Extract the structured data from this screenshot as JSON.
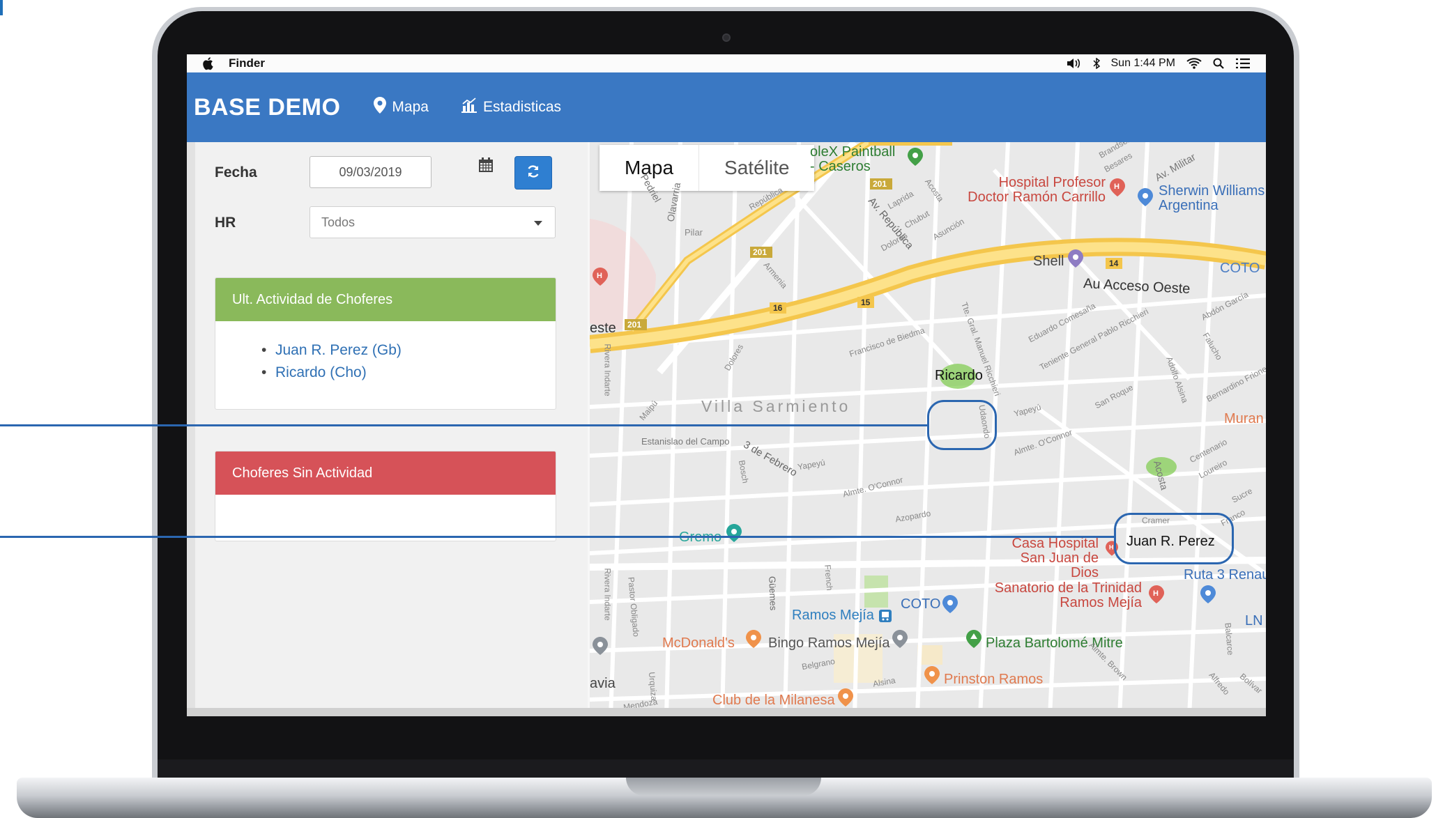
{
  "menubar": {
    "app_name": "Finder",
    "clock": "Sun 1:44 PM",
    "icons": [
      "apple-icon",
      "volume-icon",
      "bluetooth-icon",
      "wifi-icon",
      "search-icon",
      "list-icon"
    ]
  },
  "navbar": {
    "brand": "BASE DEMO",
    "links": [
      {
        "label": "Mapa",
        "icon": "map-marker-icon"
      },
      {
        "label": "Estadisticas",
        "icon": "bar-chart-icon"
      }
    ],
    "color": "#3a78c3"
  },
  "filters": {
    "date_label": "Fecha",
    "date_value": "09/03/2019",
    "hr_label": "HR",
    "hr_value": "Todos"
  },
  "panels": {
    "active": {
      "title": "Ult. Actividad de Choferes",
      "drivers": [
        "Juan R. Perez (Gb)",
        "Ricardo (Cho)"
      ],
      "color": "#8ab95b"
    },
    "inactive": {
      "title": "Choferes Sin Actividad",
      "color": "#d65258"
    }
  },
  "map": {
    "type_buttons": [
      "Mapa",
      "Satélite"
    ],
    "active_type": "Mapa",
    "markers": [
      "Ricardo",
      "Juan R. Perez"
    ],
    "places": {
      "paintball": "oleX Paintball - Caseros",
      "hospital_carrillo": "Hospital Profesor Doctor Ramón Carrillo",
      "sherwin": "Sherwin Williams Argentina",
      "shell": "Shell",
      "coto_top": "COTO",
      "acceso_oeste": "Au Acceso Oeste",
      "este": "este",
      "villa_sarmiento": "Villa Sarmiento",
      "murano": "Muran",
      "casa_hospital": "Casa Hospital San Juan de Dios",
      "ruta3": "Ruta 3 Renau",
      "sanatorio": "Sanatorio de la Trinidad Ramos Mejía",
      "ramos_mejia": "Ramos Mejía",
      "coto_bottom": "COTO",
      "mcdonalds": "McDonald's",
      "bingo": "Bingo Ramos Mejía",
      "plaza": "Plaza Bartolomé Mitre",
      "prinston": "Prinston Ramos",
      "milanesa": "Club de la Milanesa",
      "gremo": "Gremo",
      "ln": "LN",
      "via": "avia"
    },
    "streets": {
      "av_militar": "Av. Militar",
      "besares": "Besares",
      "brandsen": "Brandsen",
      "pedriel": "Pedriel",
      "olavarria": "Olavarria",
      "pilar": "Pilar",
      "republica": "República",
      "av_republica": "Av. República",
      "laprida": "Laprida",
      "acosta": "Acosta",
      "chubut": "Chubut",
      "asuncion": "Asunción",
      "dolores": "Dolores",
      "armenia": "Armenia",
      "francisco_biedma": "Francisco de Biedma",
      "tte_manuel": "Tte. Gral. Manuel Ricchieri",
      "eduardo_comesana": "Eduardo Comesaña",
      "pablo_ricchieri": "Teniente General Pablo Ricchieri",
      "abdon_garcia": "Abdón García",
      "rivera_indarte": "Rivera Indarte",
      "dolores2": "Dolores",
      "falucho": "Falucho",
      "bernardino": "Bernardino Frione",
      "adolfo_alsina": "Adolfo Alsina",
      "san_roque": "San Roque",
      "yapeyu": "Yapeyú",
      "maipu": "Maipú",
      "estanislao": "Estanislao del Campo",
      "tres_febrero": "3 de Febrero",
      "bosch": "Bosch",
      "yapeyu2": "Yapeyú",
      "almte_oconnor": "Almte. O'Connor",
      "almte_oconnor2": "Almte. O'Connor",
      "centenario": "Centenario",
      "acosta2": "Acosta",
      "lourdes": "Loureiro",
      "azopardo": "Azopardo",
      "cramer": "Cramer",
      "franco": "Franco",
      "sucre": "Sucre",
      "rivera_indarte2": "Rivera Indarte",
      "pastor_obligado": "Pastor Obligado",
      "guemes": "Güemes",
      "french": "French",
      "belgrano": "Belgrano",
      "alsina": "Alsina",
      "urquiza": "Urquiza",
      "balcarce": "Balcarce",
      "alfredo": "Alfredo",
      "bolivar": "Bolívar",
      "almte_brown": "Almte. Brown",
      "mendoza": "Mendoza",
      "udaondo": "Udaondo",
      "sucre2": "Sucre"
    },
    "route_shields": [
      "201",
      "201",
      "201",
      "16",
      "15",
      "14",
      "201"
    ]
  }
}
